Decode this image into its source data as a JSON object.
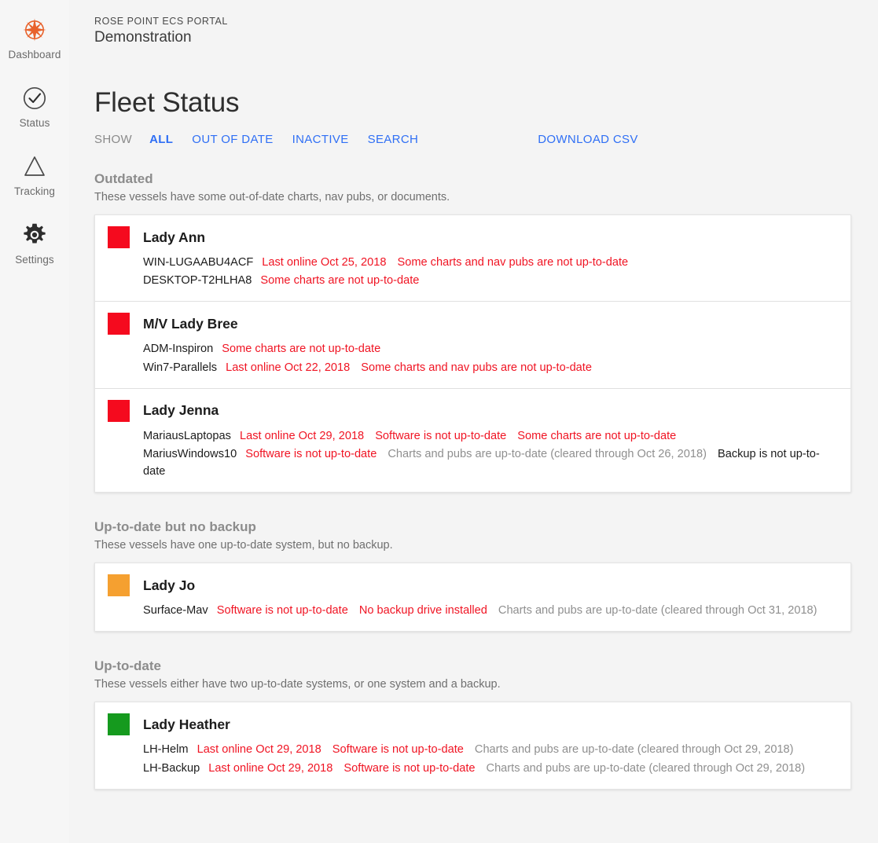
{
  "sidebar": {
    "items": [
      {
        "label": "Dashboard",
        "icon": "compass-rose-icon",
        "active": true
      },
      {
        "label": "Status",
        "icon": "check-circle-icon",
        "active": false
      },
      {
        "label": "Tracking",
        "icon": "triangle-icon",
        "active": false
      },
      {
        "label": "Settings",
        "icon": "gear-icon",
        "active": false
      }
    ]
  },
  "header": {
    "brand": "ROSE POINT ECS PORTAL",
    "account": "Demonstration",
    "page_title": "Fleet Status"
  },
  "filters": {
    "show_label": "SHOW",
    "links": [
      {
        "label": "ALL",
        "active": true
      },
      {
        "label": "OUT OF DATE",
        "active": false
      },
      {
        "label": "INACTIVE",
        "active": false
      },
      {
        "label": "SEARCH",
        "active": false
      }
    ],
    "download_label": "DOWNLOAD CSV"
  },
  "colors": {
    "accent_link": "#2f6ff5",
    "status_red": "#f50a1e",
    "status_orange": "#f5a030",
    "status_green": "#159a1e",
    "error_text": "#f01423",
    "muted_text": "#8f8f8f"
  },
  "sections": [
    {
      "title": "Outdated",
      "description": "These vessels have some out-of-date charts, nav pubs, or documents.",
      "vessels": [
        {
          "name": "Lady Ann",
          "status_color": "#f50a1e",
          "systems": [
            {
              "host": "WIN-LUGAABU4ACF",
              "statuses": [
                {
                  "text": "Last online Oct 25, 2018",
                  "tone": "bad"
                },
                {
                  "text": "Some charts and nav pubs are not up-to-date",
                  "tone": "bad"
                }
              ]
            },
            {
              "host": "DESKTOP-T2HLHA8",
              "statuses": [
                {
                  "text": "Some charts are not up-to-date",
                  "tone": "bad"
                }
              ]
            }
          ]
        },
        {
          "name": "M/V Lady Bree",
          "status_color": "#f50a1e",
          "systems": [
            {
              "host": "ADM-Inspiron",
              "statuses": [
                {
                  "text": "Some charts are not up-to-date",
                  "tone": "bad"
                }
              ]
            },
            {
              "host": "Win7-Parallels",
              "statuses": [
                {
                  "text": "Last online Oct 22, 2018",
                  "tone": "bad"
                },
                {
                  "text": "Some charts and nav pubs are not up-to-date",
                  "tone": "bad"
                }
              ]
            }
          ]
        },
        {
          "name": "Lady Jenna",
          "status_color": "#f50a1e",
          "systems": [
            {
              "host": "MariausLaptopas",
              "statuses": [
                {
                  "text": "Last online Oct 29, 2018",
                  "tone": "bad"
                },
                {
                  "text": "Software is not up-to-date",
                  "tone": "bad"
                },
                {
                  "text": "Some charts are not up-to-date",
                  "tone": "bad"
                }
              ]
            },
            {
              "host": "MariusWindows10",
              "statuses": [
                {
                  "text": "Software is not up-to-date",
                  "tone": "bad"
                },
                {
                  "text": "Charts and pubs are up-to-date (cleared through Oct 26, 2018)",
                  "tone": "muted"
                },
                {
                  "text": "Backup is not up-to-date",
                  "tone": "dark"
                }
              ]
            }
          ]
        }
      ]
    },
    {
      "title": "Up-to-date but no backup",
      "description": "These vessels have one up-to-date system, but no backup.",
      "vessels": [
        {
          "name": "Lady Jo",
          "status_color": "#f5a030",
          "systems": [
            {
              "host": "Surface-Mav",
              "statuses": [
                {
                  "text": "Software is not up-to-date",
                  "tone": "bad"
                },
                {
                  "text": "No backup drive installed",
                  "tone": "bad"
                },
                {
                  "text": "Charts and pubs are up-to-date (cleared through Oct 31, 2018)",
                  "tone": "muted"
                }
              ]
            }
          ]
        }
      ]
    },
    {
      "title": "Up-to-date",
      "description": "These vessels either have two up-to-date systems, or one system and a backup.",
      "vessels": [
        {
          "name": "Lady Heather",
          "status_color": "#159a1e",
          "systems": [
            {
              "host": "LH-Helm",
              "statuses": [
                {
                  "text": "Last online Oct 29, 2018",
                  "tone": "bad"
                },
                {
                  "text": "Software is not up-to-date",
                  "tone": "bad"
                },
                {
                  "text": "Charts and pubs are up-to-date (cleared through Oct 29, 2018)",
                  "tone": "muted"
                }
              ]
            },
            {
              "host": "LH-Backup",
              "statuses": [
                {
                  "text": "Last online Oct 29, 2018",
                  "tone": "bad"
                },
                {
                  "text": "Software is not up-to-date",
                  "tone": "bad"
                },
                {
                  "text": "Charts and pubs are up-to-date (cleared through Oct 29, 2018)",
                  "tone": "muted"
                }
              ]
            }
          ]
        }
      ]
    }
  ]
}
